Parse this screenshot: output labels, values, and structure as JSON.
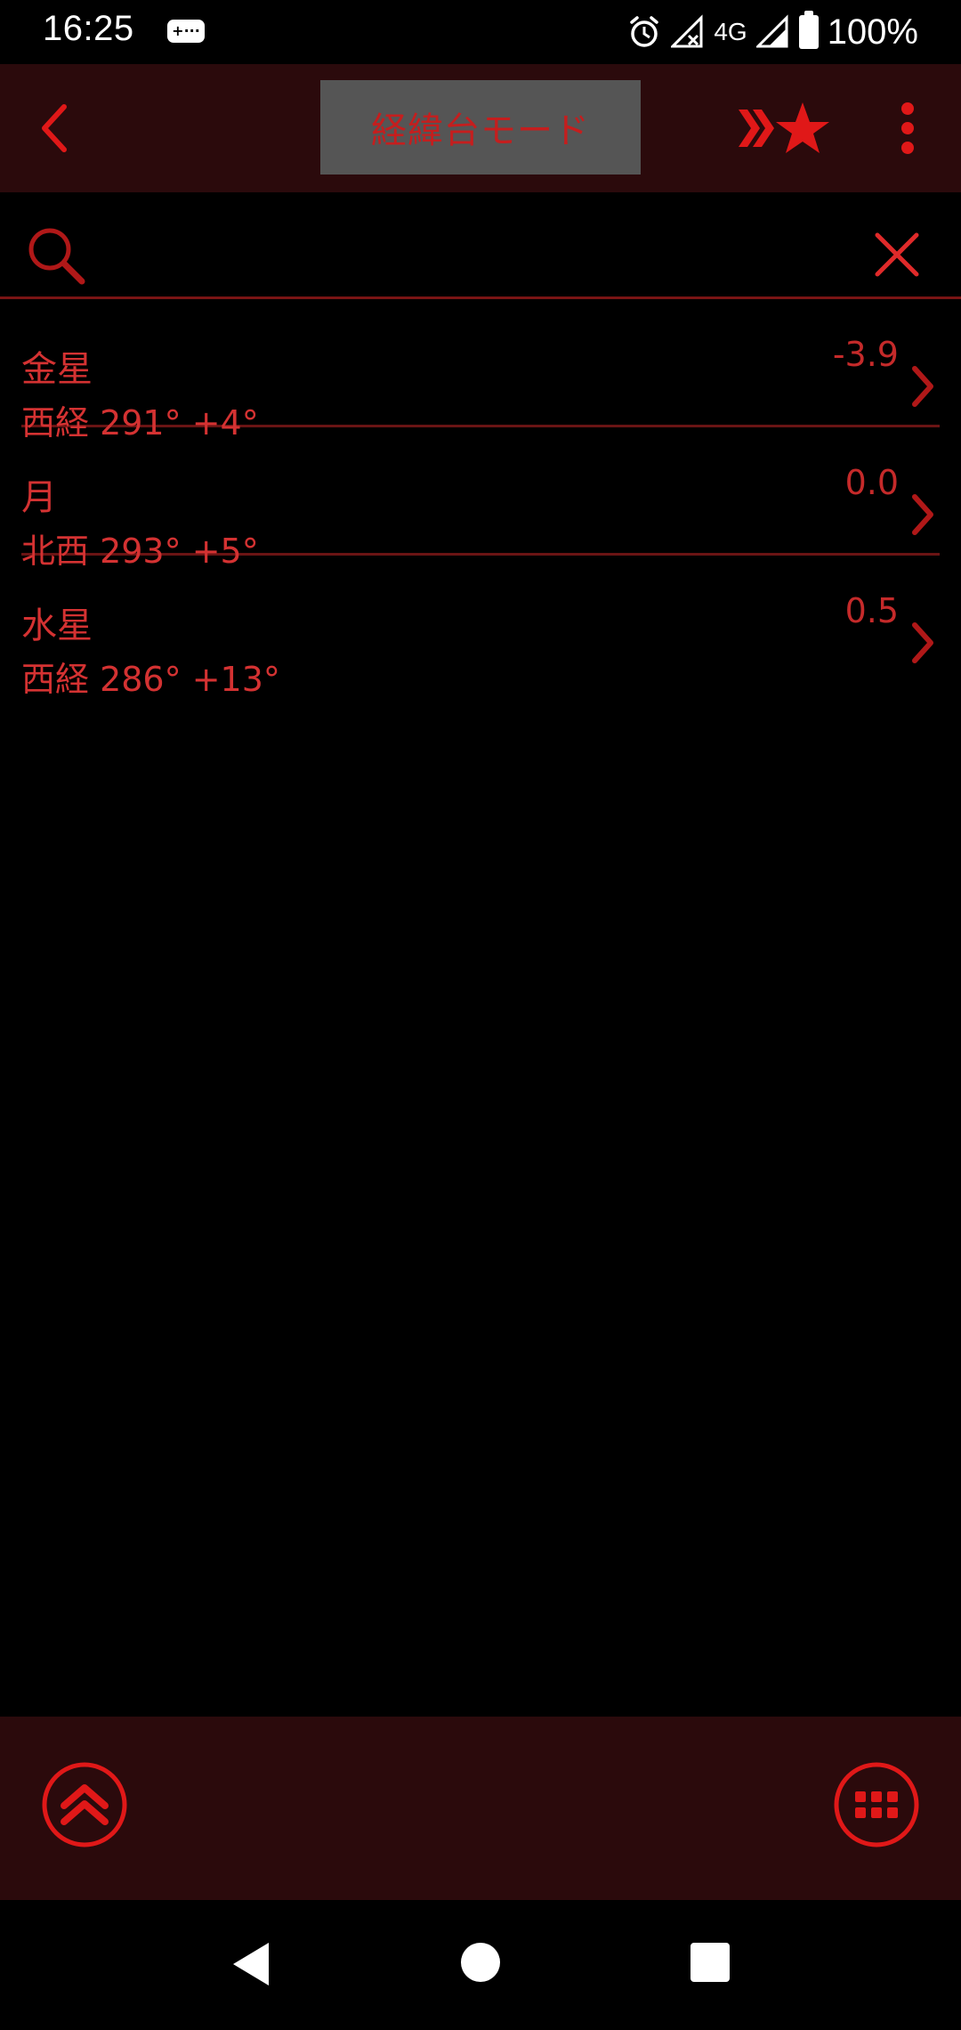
{
  "status_bar": {
    "time": "16:25",
    "network": "4G",
    "battery": "100%",
    "icons": [
      "game-controller-icon",
      "alarm-icon",
      "no-signal-icon",
      "cell-signal-icon",
      "battery-icon"
    ]
  },
  "toolbar": {
    "title": "経緯台モード",
    "icons": [
      "back-chevron-icon",
      "favorites-star-icon",
      "more-vert-icon"
    ]
  },
  "search": {
    "value": "",
    "placeholder": "",
    "icons": [
      "search-icon",
      "clear-icon"
    ]
  },
  "results": [
    {
      "name": "金星",
      "coords": "西経 291° +4°",
      "magnitude": "-3.9"
    },
    {
      "name": "月",
      "coords": "北西 293° +5°",
      "magnitude": "0.0"
    },
    {
      "name": "水星",
      "coords": "西経 286° +13°",
      "magnitude": "0.5"
    }
  ],
  "bottom_bar": {
    "icons": [
      "scroll-top-icon",
      "grid-menu-icon"
    ]
  },
  "nav_bar": {
    "icons": [
      "nav-back-icon",
      "nav-home-icon",
      "nav-recents-icon"
    ]
  },
  "colors": {
    "accent": "#e01818",
    "text_red": "#d43232",
    "toolbar_bg": "#2b0a0c",
    "title_bg": "#555555",
    "background": "#000000"
  }
}
